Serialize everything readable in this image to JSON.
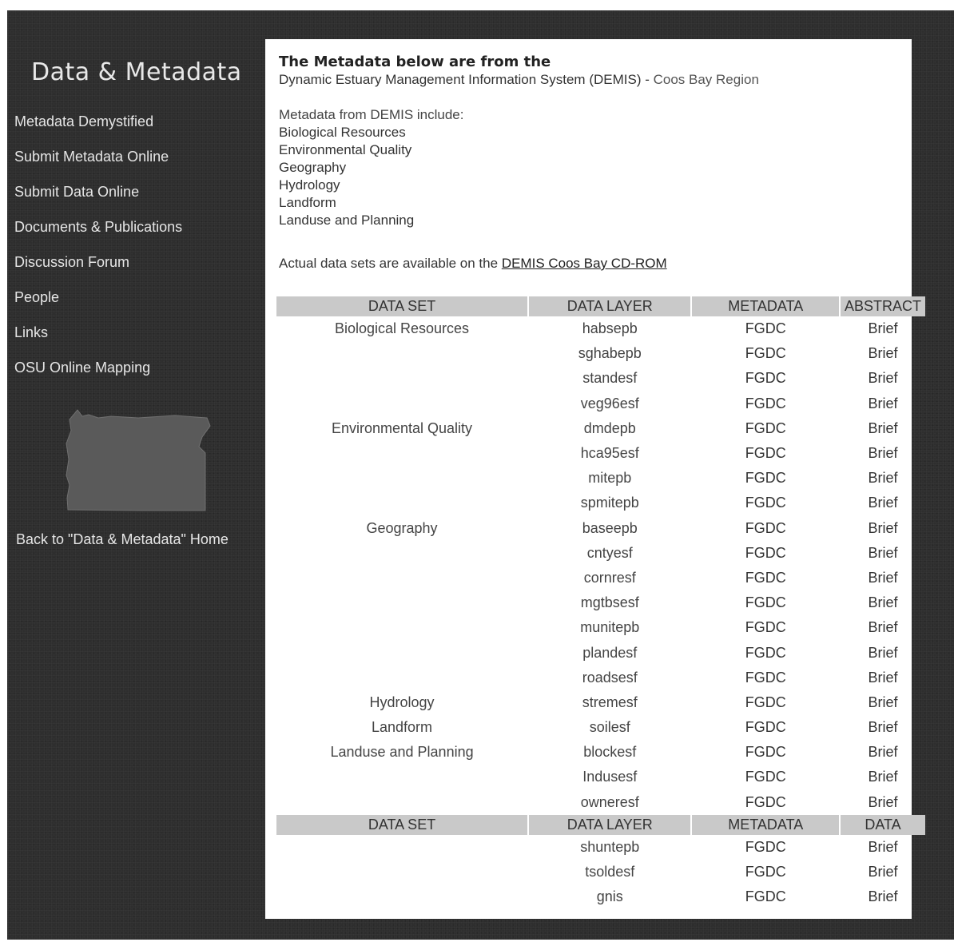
{
  "sidebar": {
    "title": "Data & Metadata",
    "nav": [
      {
        "label": "Metadata Demystified"
      },
      {
        "label": "Submit Metadata Online"
      },
      {
        "label": "Submit Data Online"
      },
      {
        "label": "Documents & Publications"
      },
      {
        "label": "Discussion Forum"
      },
      {
        "label": "People"
      },
      {
        "label": "Links"
      },
      {
        "label": "OSU Online Mapping"
      }
    ],
    "map_icon": "oregon-state-map",
    "back_link": "Back to \"Data & Metadata\" Home"
  },
  "content": {
    "heading": "The Metadata below are from the",
    "subheading": "Dynamic Estuary Management Information System (DEMIS) -",
    "region": "Coos Bay Region",
    "intro_label": "Metadata from DEMIS include:",
    "categories": [
      "Biological Resources",
      "Environmental Quality",
      "Geography",
      "Hydrology",
      "Landform",
      "Landuse and Planning"
    ],
    "avail_text": "Actual data sets are available on the",
    "avail_link": "DEMIS Coos Bay CD-ROM"
  },
  "table1": {
    "headers": [
      "DATA SET",
      "DATA LAYER",
      "METADATA",
      "ABSTRACT"
    ],
    "rows": [
      [
        "Biological Resources",
        "habsepb",
        "FGDC",
        "Brief"
      ],
      [
        "",
        "sghabepb",
        "FGDC",
        "Brief"
      ],
      [
        "",
        "standesf",
        "FGDC",
        "Brief"
      ],
      [
        "",
        "veg96esf",
        "FGDC",
        "Brief"
      ],
      [
        "Environmental Quality",
        "dmdepb",
        "FGDC",
        "Brief"
      ],
      [
        "",
        "hca95esf",
        "FGDC",
        "Brief"
      ],
      [
        "",
        "mitepb",
        "FGDC",
        "Brief"
      ],
      [
        "",
        "spmitepb",
        "FGDC",
        "Brief"
      ],
      [
        "Geography",
        "baseepb",
        "FGDC",
        "Brief"
      ],
      [
        "",
        "cntyesf",
        "FGDC",
        "Brief"
      ],
      [
        "",
        "cornresf",
        "FGDC",
        "Brief"
      ],
      [
        "",
        "mgtbsesf",
        "FGDC",
        "Brief"
      ],
      [
        "",
        "munitepb",
        "FGDC",
        "Brief"
      ],
      [
        "",
        "plandesf",
        "FGDC",
        "Brief"
      ],
      [
        "",
        "roadsesf",
        "FGDC",
        "Brief"
      ],
      [
        "Hydrology",
        "stremesf",
        "FGDC",
        "Brief"
      ],
      [
        "Landform",
        "soilesf",
        "FGDC",
        "Brief"
      ],
      [
        "Landuse and Planning",
        "blockesf",
        "FGDC",
        "Brief"
      ],
      [
        "",
        "Indusesf",
        "FGDC",
        "Brief"
      ],
      [
        "",
        "owneresf",
        "FGDC",
        "Brief"
      ]
    ]
  },
  "table2": {
    "headers": [
      "DATA SET",
      "DATA LAYER",
      "METADATA",
      "DATA"
    ],
    "rows": [
      [
        "",
        "shuntepb",
        "FGDC",
        "Brief"
      ],
      [
        "",
        "tsoldesf",
        "FGDC",
        "Brief"
      ],
      [
        "",
        "gnis",
        "FGDC",
        "Brief"
      ]
    ]
  }
}
